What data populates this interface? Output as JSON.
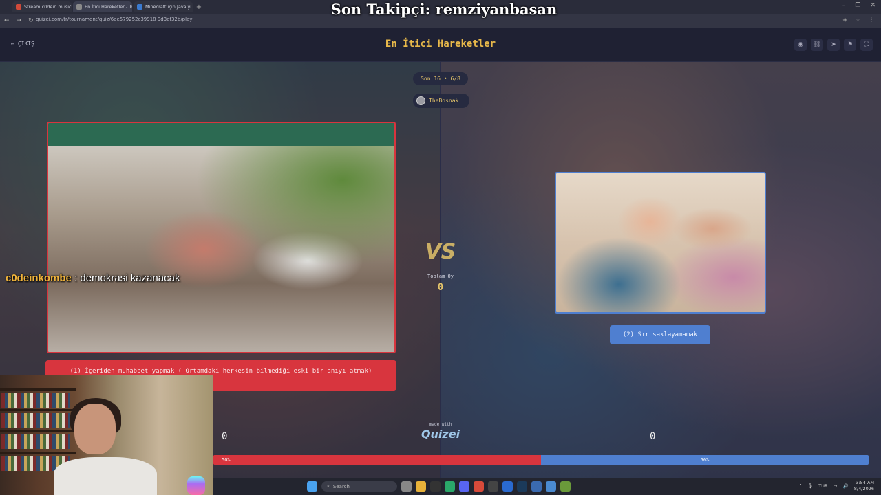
{
  "stream_overlay": {
    "title": "Son Takipçi: remziyanbasan",
    "chat_user": "c0deinkombe",
    "chat_message": " : demokrasi kazanacak"
  },
  "browser": {
    "tabs": [
      {
        "label": "Stream c0dein music |",
        "color": "#d04a3a"
      },
      {
        "label": "En İtici Hareketler - Tor",
        "color": "#8a8a8a",
        "active": true
      },
      {
        "label": "Minecraft için Java'yı in",
        "color": "#3a7ad0"
      }
    ],
    "new_tab": "+",
    "url": "quizei.com/tr/tournament/quiz/6ae579252c39918 9d3ef32b/play"
  },
  "header": {
    "exit_label": "ÇIKIŞ",
    "title": "En İtici Hareketler",
    "icons": [
      "eye-icon",
      "link-icon",
      "send-icon",
      "flag-icon",
      "fullscreen-icon"
    ]
  },
  "match": {
    "round_label": "Son 16 • 6/8",
    "user": "TheBosnak",
    "vs_label": "VS",
    "total_votes_label": "Toplam Oy",
    "total_votes": "0",
    "left": {
      "label": "(1) İçeriden muhabbet yapmak ( Ortamdaki herkesin bilmediği eski bir anıyı atmak)",
      "score": "0",
      "percent_label": "50%",
      "percent": 50,
      "color": "#d8353e"
    },
    "right": {
      "label": "(2) Sır saklayamamak",
      "score": "0",
      "percent_label": "50%",
      "percent": 50,
      "color": "#4f7fd0"
    }
  },
  "footer": {
    "made_with": "made with",
    "brand": "Quizei"
  },
  "taskbar": {
    "search_placeholder": "Search",
    "language": "TUR",
    "time": "3:54 AM",
    "date": "8/4/2026"
  }
}
